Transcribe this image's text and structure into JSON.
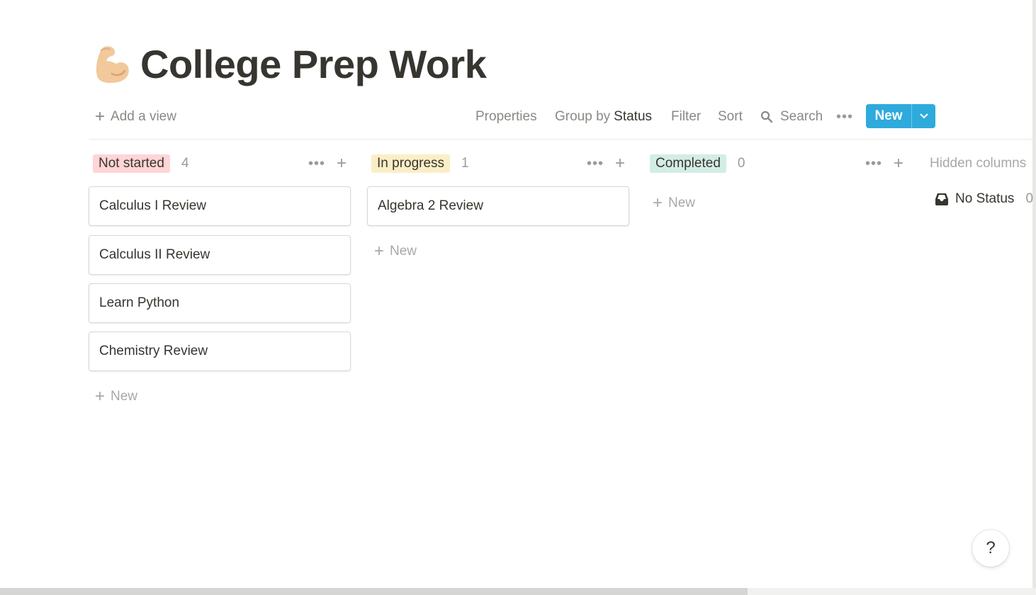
{
  "page": {
    "title": "College Prep Work",
    "icon": "flexed-biceps-emoji"
  },
  "toolbar": {
    "add_view": "Add a view",
    "properties": "Properties",
    "group_by_prefix": "Group by",
    "group_by_value": "Status",
    "filter": "Filter",
    "sort": "Sort",
    "search": "Search",
    "more": "•••",
    "new_label": "New"
  },
  "columns": [
    {
      "label": "Not started",
      "count": "4",
      "color": "#ffd5d5",
      "cards": [
        "Calculus I Review",
        "Calculus II Review",
        "Learn Python",
        "Chemistry Review"
      ],
      "new_label": "New"
    },
    {
      "label": "In progress",
      "count": "1",
      "color": "#fbeec7",
      "cards": [
        "Algebra 2 Review"
      ],
      "new_label": "New"
    },
    {
      "label": "Completed",
      "count": "0",
      "color": "#d4ece6",
      "cards": [],
      "new_label": "New"
    }
  ],
  "hidden": {
    "title": "Hidden columns",
    "no_status": "No Status",
    "no_status_count": "0"
  },
  "colors": {
    "accent": "#2eaadc"
  },
  "help": "?"
}
